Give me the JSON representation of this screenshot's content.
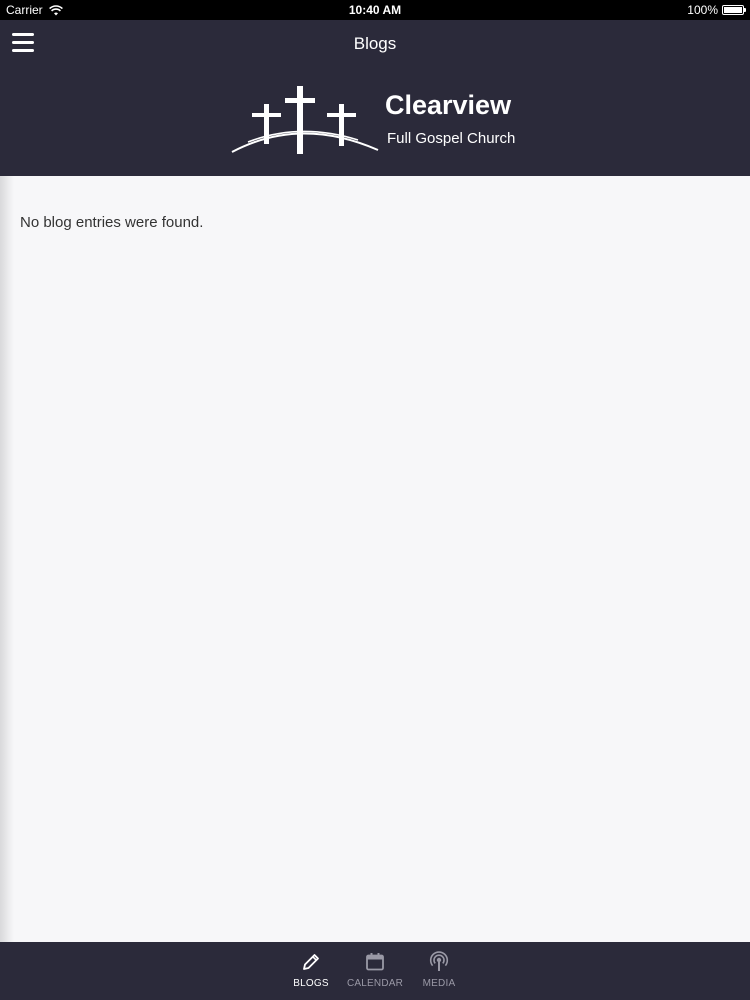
{
  "status_bar": {
    "carrier": "Carrier",
    "time": "10:40 AM",
    "battery": "100%",
    "battery_level": 1.0
  },
  "header": {
    "title": "Blogs",
    "menu_icon": "hamburger-menu-icon",
    "logo": {
      "name": "Clearview",
      "subtitle": "Full Gospel Church",
      "icon": "three-crosses-icon"
    }
  },
  "content": {
    "empty_message": "No blog entries were found."
  },
  "tabs": [
    {
      "label": "BLOGS",
      "icon": "pencil-icon",
      "active": true
    },
    {
      "label": "CALENDAR",
      "icon": "calendar-icon",
      "active": false
    },
    {
      "label": "MEDIA",
      "icon": "podcast-icon",
      "active": false
    }
  ],
  "colors": {
    "header_bg": "#2b2a3a",
    "content_bg": "#f7f7f9",
    "tab_active": "#ffffff",
    "tab_inactive": "#9a99a6"
  }
}
